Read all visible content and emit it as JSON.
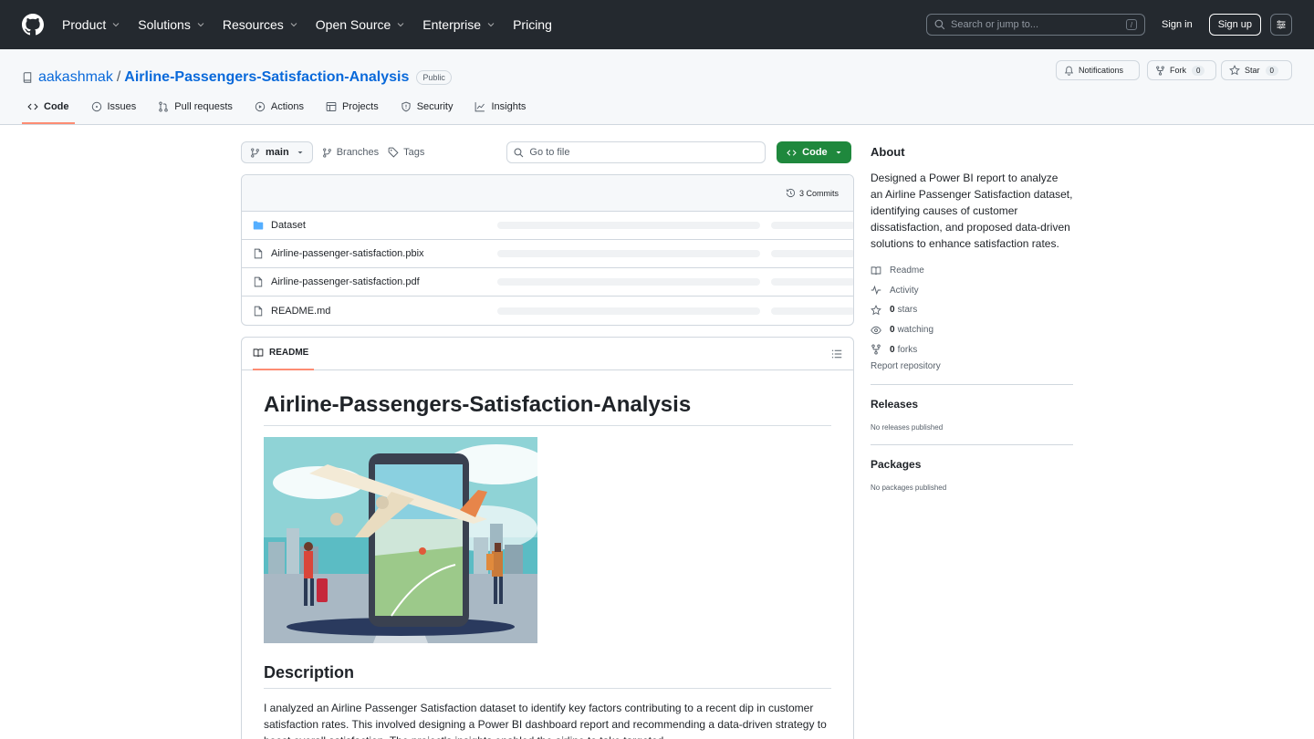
{
  "header": {
    "nav": [
      "Product",
      "Solutions",
      "Resources",
      "Open Source",
      "Enterprise",
      "Pricing"
    ],
    "search_placeholder": "Search or jump to...",
    "search_shortcut": "/",
    "signin": "Sign in",
    "signup": "Sign up"
  },
  "repo": {
    "owner": "aakashmak",
    "separator": "/",
    "name": "Airline-Passengers-Satisfaction-Analysis",
    "visibility": "Public",
    "notifications": "Notifications",
    "fork_label": "Fork",
    "fork_count": "0",
    "star_label": "Star",
    "star_count": "0"
  },
  "tabs": [
    "Code",
    "Issues",
    "Pull requests",
    "Actions",
    "Projects",
    "Security",
    "Insights"
  ],
  "toolbar": {
    "branch": "main",
    "branches": "Branches",
    "tags": "Tags",
    "goto_placeholder": "Go to file",
    "code_button": "Code"
  },
  "files": {
    "commits": "3 Commits",
    "items": [
      {
        "name": "Dataset",
        "type": "folder"
      },
      {
        "name": "Airline-passenger-satisfaction.pbix",
        "type": "file"
      },
      {
        "name": "Airline-passenger-satisfaction.pdf",
        "type": "file"
      },
      {
        "name": "README.md",
        "type": "file"
      }
    ]
  },
  "readme": {
    "tab": "README",
    "title": "Airline-Passengers-Satisfaction-Analysis",
    "section": "Description",
    "paragraph": "I analyzed an Airline Passenger Satisfaction dataset to identify key factors contributing to a recent dip in customer satisfaction rates. This involved designing a Power BI dashboard report and recommending a data-driven strategy to boost overall satisfaction. The project's insights enabled the airline to take targeted"
  },
  "about": {
    "title": "About",
    "description": "Designed a Power BI report to analyze an Airline Passenger Satisfaction dataset, identifying causes of customer dissatisfaction, and proposed data-driven solutions to enhance satisfaction rates.",
    "readme": "Readme",
    "activity": "Activity",
    "stars_count": "0",
    "stars_label": "stars",
    "watching_count": "0",
    "watching_label": "watching",
    "forks_count": "0",
    "forks_label": "forks",
    "report": "Report repository"
  },
  "releases": {
    "title": "Releases",
    "empty": "No releases published"
  },
  "packages": {
    "title": "Packages",
    "empty": "No packages published"
  },
  "colors": {
    "topbar": "#24292f",
    "link": "#0969da",
    "code_button": "#1f883d",
    "active_tab": "#fd8c73"
  }
}
